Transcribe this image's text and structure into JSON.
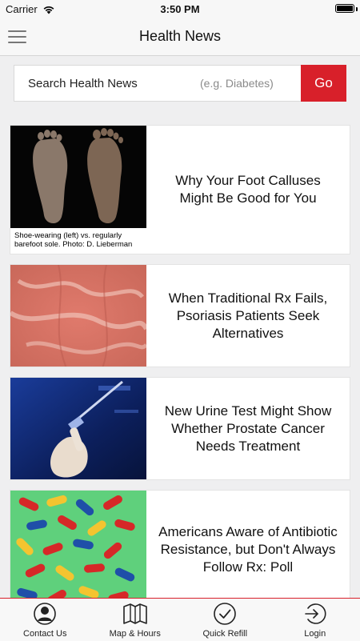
{
  "status_bar": {
    "carrier": "Carrier",
    "time": "3:50 PM"
  },
  "nav": {
    "title": "Health News"
  },
  "search": {
    "label": "Search Health News",
    "placeholder": "(e.g. Diabetes)",
    "button": "Go"
  },
  "articles": [
    {
      "headline": "Why Your Foot Calluses Might Be Good for You",
      "image_caption": "Shoe-wearing (left) vs. regularly barefoot sole. Photo: D. Lieberman",
      "image": "feet-soles-photo"
    },
    {
      "headline": "When Traditional Rx Fails, Psoriasis Patients Seek Alternatives",
      "image": "psoriasis-skin-photo"
    },
    {
      "headline": "New Urine Test Might Show Whether Prostate Cancer Needs Treatment",
      "image": "lab-pipette-photo"
    },
    {
      "headline": "Americans Aware of Antibiotic Resistance, but Don't Always Follow Rx: Poll",
      "image": "pills-capsules-photo"
    }
  ],
  "tabs": [
    {
      "label": "Contact Us",
      "icon": "contact-icon"
    },
    {
      "label": "Map & Hours",
      "icon": "map-icon"
    },
    {
      "label": "Quick Refill",
      "icon": "checkmark-icon"
    },
    {
      "label": "Login",
      "icon": "login-icon"
    }
  ],
  "colors": {
    "accent": "#d8202a",
    "background": "#efeff0"
  }
}
